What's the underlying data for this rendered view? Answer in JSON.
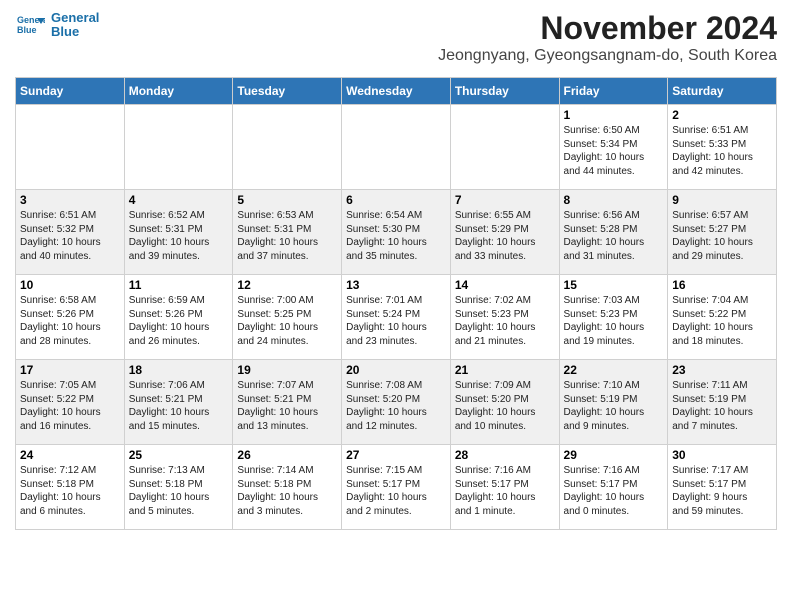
{
  "logo": {
    "text_line1": "General",
    "text_line2": "Blue"
  },
  "title": "November 2024",
  "subtitle": "Jeongnyang, Gyeongsangnam-do, South Korea",
  "days_of_week": [
    "Sunday",
    "Monday",
    "Tuesday",
    "Wednesday",
    "Thursday",
    "Friday",
    "Saturday"
  ],
  "weeks": [
    {
      "alt": false,
      "days": [
        {
          "num": "",
          "info": ""
        },
        {
          "num": "",
          "info": ""
        },
        {
          "num": "",
          "info": ""
        },
        {
          "num": "",
          "info": ""
        },
        {
          "num": "",
          "info": ""
        },
        {
          "num": "1",
          "info": "Sunrise: 6:50 AM\nSunset: 5:34 PM\nDaylight: 10 hours\nand 44 minutes."
        },
        {
          "num": "2",
          "info": "Sunrise: 6:51 AM\nSunset: 5:33 PM\nDaylight: 10 hours\nand 42 minutes."
        }
      ]
    },
    {
      "alt": true,
      "days": [
        {
          "num": "3",
          "info": "Sunrise: 6:51 AM\nSunset: 5:32 PM\nDaylight: 10 hours\nand 40 minutes."
        },
        {
          "num": "4",
          "info": "Sunrise: 6:52 AM\nSunset: 5:31 PM\nDaylight: 10 hours\nand 39 minutes."
        },
        {
          "num": "5",
          "info": "Sunrise: 6:53 AM\nSunset: 5:31 PM\nDaylight: 10 hours\nand 37 minutes."
        },
        {
          "num": "6",
          "info": "Sunrise: 6:54 AM\nSunset: 5:30 PM\nDaylight: 10 hours\nand 35 minutes."
        },
        {
          "num": "7",
          "info": "Sunrise: 6:55 AM\nSunset: 5:29 PM\nDaylight: 10 hours\nand 33 minutes."
        },
        {
          "num": "8",
          "info": "Sunrise: 6:56 AM\nSunset: 5:28 PM\nDaylight: 10 hours\nand 31 minutes."
        },
        {
          "num": "9",
          "info": "Sunrise: 6:57 AM\nSunset: 5:27 PM\nDaylight: 10 hours\nand 29 minutes."
        }
      ]
    },
    {
      "alt": false,
      "days": [
        {
          "num": "10",
          "info": "Sunrise: 6:58 AM\nSunset: 5:26 PM\nDaylight: 10 hours\nand 28 minutes."
        },
        {
          "num": "11",
          "info": "Sunrise: 6:59 AM\nSunset: 5:26 PM\nDaylight: 10 hours\nand 26 minutes."
        },
        {
          "num": "12",
          "info": "Sunrise: 7:00 AM\nSunset: 5:25 PM\nDaylight: 10 hours\nand 24 minutes."
        },
        {
          "num": "13",
          "info": "Sunrise: 7:01 AM\nSunset: 5:24 PM\nDaylight: 10 hours\nand 23 minutes."
        },
        {
          "num": "14",
          "info": "Sunrise: 7:02 AM\nSunset: 5:23 PM\nDaylight: 10 hours\nand 21 minutes."
        },
        {
          "num": "15",
          "info": "Sunrise: 7:03 AM\nSunset: 5:23 PM\nDaylight: 10 hours\nand 19 minutes."
        },
        {
          "num": "16",
          "info": "Sunrise: 7:04 AM\nSunset: 5:22 PM\nDaylight: 10 hours\nand 18 minutes."
        }
      ]
    },
    {
      "alt": true,
      "days": [
        {
          "num": "17",
          "info": "Sunrise: 7:05 AM\nSunset: 5:22 PM\nDaylight: 10 hours\nand 16 minutes."
        },
        {
          "num": "18",
          "info": "Sunrise: 7:06 AM\nSunset: 5:21 PM\nDaylight: 10 hours\nand 15 minutes."
        },
        {
          "num": "19",
          "info": "Sunrise: 7:07 AM\nSunset: 5:21 PM\nDaylight: 10 hours\nand 13 minutes."
        },
        {
          "num": "20",
          "info": "Sunrise: 7:08 AM\nSunset: 5:20 PM\nDaylight: 10 hours\nand 12 minutes."
        },
        {
          "num": "21",
          "info": "Sunrise: 7:09 AM\nSunset: 5:20 PM\nDaylight: 10 hours\nand 10 minutes."
        },
        {
          "num": "22",
          "info": "Sunrise: 7:10 AM\nSunset: 5:19 PM\nDaylight: 10 hours\nand 9 minutes."
        },
        {
          "num": "23",
          "info": "Sunrise: 7:11 AM\nSunset: 5:19 PM\nDaylight: 10 hours\nand 7 minutes."
        }
      ]
    },
    {
      "alt": false,
      "days": [
        {
          "num": "24",
          "info": "Sunrise: 7:12 AM\nSunset: 5:18 PM\nDaylight: 10 hours\nand 6 minutes."
        },
        {
          "num": "25",
          "info": "Sunrise: 7:13 AM\nSunset: 5:18 PM\nDaylight: 10 hours\nand 5 minutes."
        },
        {
          "num": "26",
          "info": "Sunrise: 7:14 AM\nSunset: 5:18 PM\nDaylight: 10 hours\nand 3 minutes."
        },
        {
          "num": "27",
          "info": "Sunrise: 7:15 AM\nSunset: 5:17 PM\nDaylight: 10 hours\nand 2 minutes."
        },
        {
          "num": "28",
          "info": "Sunrise: 7:16 AM\nSunset: 5:17 PM\nDaylight: 10 hours\nand 1 minute."
        },
        {
          "num": "29",
          "info": "Sunrise: 7:16 AM\nSunset: 5:17 PM\nDaylight: 10 hours\nand 0 minutes."
        },
        {
          "num": "30",
          "info": "Sunrise: 7:17 AM\nSunset: 5:17 PM\nDaylight: 9 hours\nand 59 minutes."
        }
      ]
    }
  ],
  "colors": {
    "header_bg": "#2E75B6",
    "header_text": "#ffffff",
    "alt_row_bg": "#f0f0f0",
    "norm_row_bg": "#ffffff"
  }
}
